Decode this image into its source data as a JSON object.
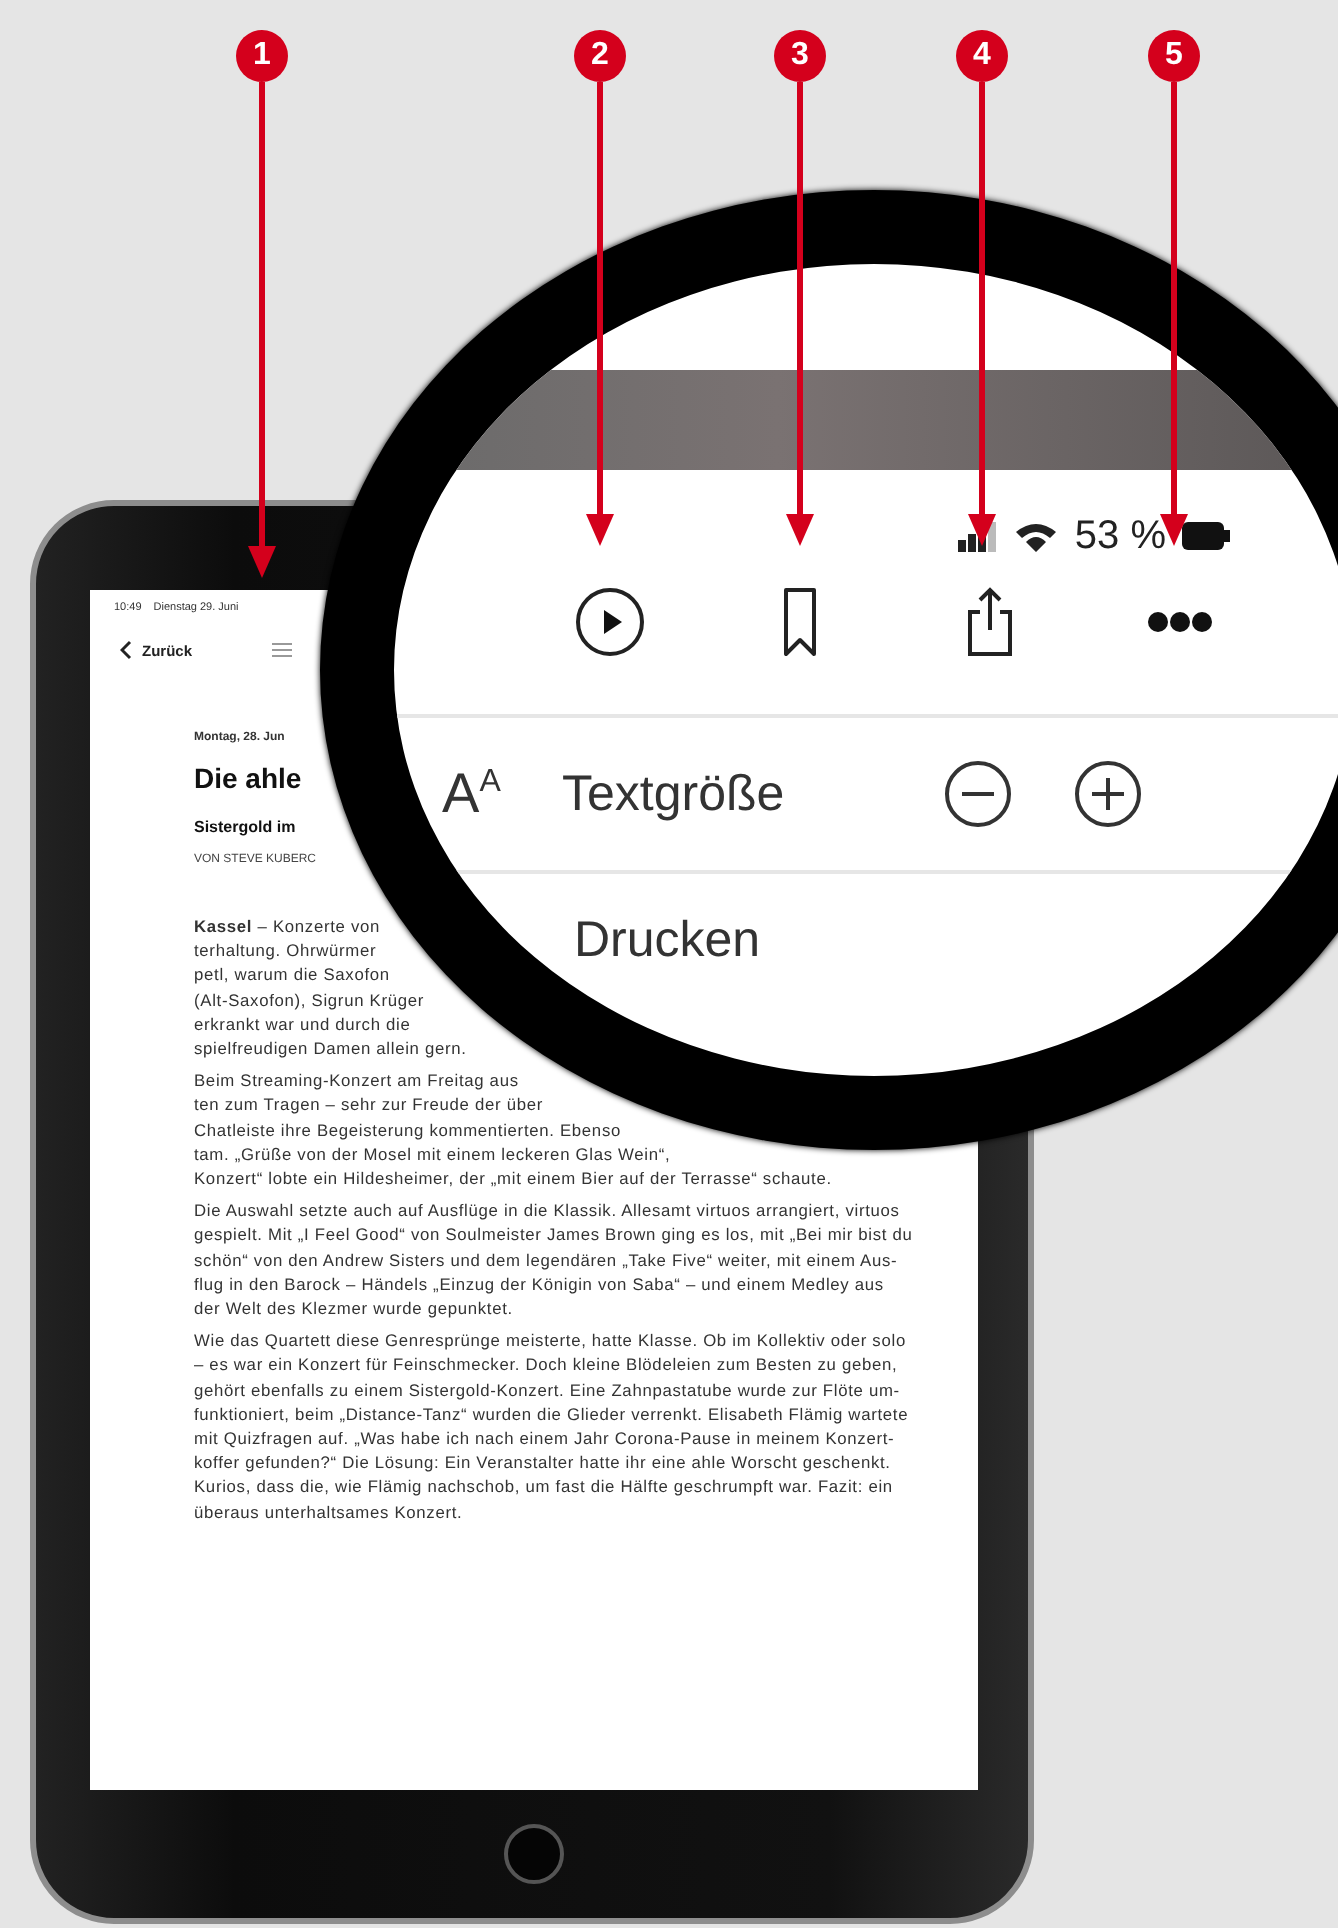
{
  "annotations": [
    {
      "number": "1"
    },
    {
      "number": "2"
    },
    {
      "number": "3"
    },
    {
      "number": "4"
    },
    {
      "number": "5"
    }
  ],
  "tablet": {
    "status_bar": {
      "time": "10:49",
      "date": "Dienstag 29. Juni"
    },
    "nav": {
      "back": "Zurück"
    },
    "article": {
      "date": "Montag, 28. Jun",
      "headline": "Die ahle",
      "subheadline": "Sistergold im",
      "byline": "VON STEVE KUBERC",
      "paragraphs": [
        {
          "lines": [
            "**Kassel** – Konzerte von",
            "terhaltung. Ohrwürmer",
            "petl, warum die Saxofon",
            "(Alt-Saxofon), Sigrun Krüger",
            "erkrankt war und durch die",
            "spielfreudigen Damen allein gern."
          ]
        },
        {
          "lines": [
            "Beim Streaming-Konzert am Freitag aus",
            "ten zum Tragen – sehr zur Freude der über",
            "Chatleiste ihre Begeisterung kommentierten. Ebenso",
            "tam. „Grüße von der Mosel mit einem leckeren Glas Wein“,",
            "Konzert“ lobte ein Hildesheimer, der „mit einem Bier auf der Terrasse“ schaute."
          ]
        },
        {
          "lines": [
            "Die Auswahl setzte auch auf Ausflüge in die Klassik. Allesamt virtuos arrangiert, virtuos",
            "gespielt. Mit „I Feel Good“ von Soulmeister James Brown ging es los, mit „Bei mir bist du",
            "schön“ von den Andrew Sisters und dem legendären „Take Five“ weiter, mit einem Aus-",
            "flug in den Barock – Händels „Einzug der Königin von Saba“ – und einem Medley aus",
            "der Welt des Klezmer wurde gepunktet."
          ]
        },
        {
          "lines": [
            "Wie das Quartett diese Genresprünge meisterte, hatte Klasse. Ob im Kollektiv oder solo",
            "– es war ein Konzert für Feinschmecker. Doch kleine Blödeleien zum Besten zu geben,",
            "gehört ebenfalls zu einem Sistergold-Konzert. Eine Zahnpastatube wurde zur Flöte um-",
            "funktioniert, beim „Distance-Tanz“ wurden die Glieder verrenkt. Elisabeth Flämig wartete",
            "mit Quizfragen auf. „Was habe ich nach einem Jahr Corona-Pause in meinem Konzert-",
            "koffer gefunden?“ Die Lösung: Ein Veranstalter hatte ihr eine ahle Worscht geschenkt.",
            "Kurios, dass die, wie Flämig nachschob, um fast die Hälfte geschrumpft war. Fazit: ein",
            "überaus unterhaltsames Konzert."
          ]
        }
      ]
    }
  },
  "magnifier": {
    "status_bar": {
      "battery": "53 %"
    },
    "toolbar": [
      {
        "kind": "play"
      },
      {
        "kind": "bookmark"
      },
      {
        "kind": "share"
      },
      {
        "kind": "more"
      }
    ],
    "menu": [
      {
        "kind": "stepper",
        "icon": "A$^{A}$",
        "label": "Textgröße"
      },
      {
        "kind": "action",
        "label": "Drucken"
      }
    ]
  }
}
